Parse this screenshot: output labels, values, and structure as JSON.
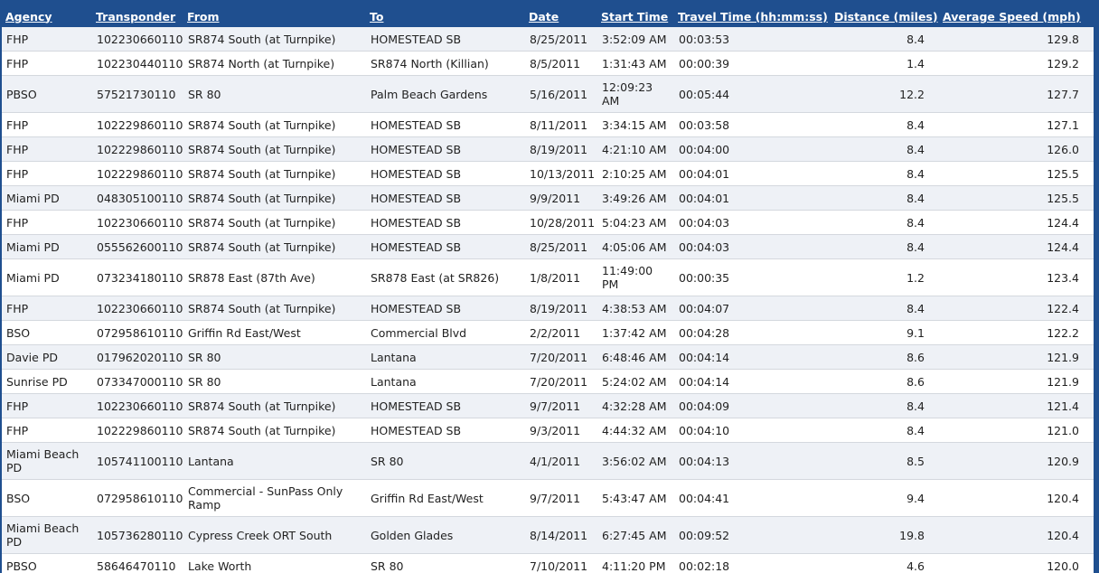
{
  "columns": [
    "Agency",
    "Transponder",
    "From",
    "To",
    "Date",
    "Start Time",
    "Travel Time (hh:mm:ss)",
    "Distance (miles)",
    "Average Speed (mph)"
  ],
  "rows": [
    [
      "FHP",
      "102230660110",
      "SR874 South (at Turnpike)",
      "HOMESTEAD SB",
      "8/25/2011",
      "3:52:09 AM",
      "00:03:53",
      "8.4",
      "129.8"
    ],
    [
      "FHP",
      "102230440110",
      "SR874 North (at Turnpike)",
      "SR874 North (Killian)",
      "8/5/2011",
      "1:31:43 AM",
      "00:00:39",
      "1.4",
      "129.2"
    ],
    [
      "PBSO",
      "57521730110",
      "SR 80",
      "Palm Beach Gardens",
      "5/16/2011",
      "12:09:23 AM",
      "00:05:44",
      "12.2",
      "127.7"
    ],
    [
      "FHP",
      "102229860110",
      "SR874 South (at Turnpike)",
      "HOMESTEAD SB",
      "8/11/2011",
      "3:34:15 AM",
      "00:03:58",
      "8.4",
      "127.1"
    ],
    [
      "FHP",
      "102229860110",
      "SR874 South (at Turnpike)",
      "HOMESTEAD SB",
      "8/19/2011",
      "4:21:10 AM",
      "00:04:00",
      "8.4",
      "126.0"
    ],
    [
      "FHP",
      "102229860110",
      "SR874 South (at Turnpike)",
      "HOMESTEAD SB",
      "10/13/2011",
      "2:10:25 AM",
      "00:04:01",
      "8.4",
      "125.5"
    ],
    [
      "Miami PD",
      "048305100110",
      "SR874 South (at Turnpike)",
      "HOMESTEAD SB",
      "9/9/2011",
      "3:49:26 AM",
      "00:04:01",
      "8.4",
      "125.5"
    ],
    [
      "FHP",
      "102230660110",
      "SR874 South (at Turnpike)",
      "HOMESTEAD SB",
      "10/28/2011",
      "5:04:23 AM",
      "00:04:03",
      "8.4",
      "124.4"
    ],
    [
      "Miami PD",
      "055562600110",
      "SR874 South (at Turnpike)",
      "HOMESTEAD SB",
      "8/25/2011",
      "4:05:06 AM",
      "00:04:03",
      "8.4",
      "124.4"
    ],
    [
      "Miami PD",
      "073234180110",
      "SR878 East (87th Ave)",
      "SR878 East (at SR826)",
      "1/8/2011",
      "11:49:00 PM",
      "00:00:35",
      "1.2",
      "123.4"
    ],
    [
      "FHP",
      "102230660110",
      "SR874 South (at Turnpike)",
      "HOMESTEAD SB",
      "8/19/2011",
      "4:38:53 AM",
      "00:04:07",
      "8.4",
      "122.4"
    ],
    [
      "BSO",
      "072958610110",
      "Griffin Rd East/West",
      "Commercial Blvd",
      "2/2/2011",
      "1:37:42 AM",
      "00:04:28",
      "9.1",
      "122.2"
    ],
    [
      "Davie PD",
      "017962020110",
      "SR 80",
      "Lantana",
      "7/20/2011",
      "6:48:46 AM",
      "00:04:14",
      "8.6",
      "121.9"
    ],
    [
      "Sunrise PD",
      "073347000110",
      "SR 80",
      "Lantana",
      "7/20/2011",
      "5:24:02 AM",
      "00:04:14",
      "8.6",
      "121.9"
    ],
    [
      "FHP",
      "102230660110",
      "SR874 South (at Turnpike)",
      "HOMESTEAD SB",
      "9/7/2011",
      "4:32:28 AM",
      "00:04:09",
      "8.4",
      "121.4"
    ],
    [
      "FHP",
      "102229860110",
      "SR874 South (at Turnpike)",
      "HOMESTEAD SB",
      "9/3/2011",
      "4:44:32 AM",
      "00:04:10",
      "8.4",
      "121.0"
    ],
    [
      "Miami Beach PD",
      "105741100110",
      "Lantana",
      "SR 80",
      "4/1/2011",
      "3:56:02 AM",
      "00:04:13",
      "8.5",
      "120.9"
    ],
    [
      "BSO",
      "072958610110",
      "Commercial - SunPass Only Ramp",
      "Griffin Rd East/West",
      "9/7/2011",
      "5:43:47 AM",
      "00:04:41",
      "9.4",
      "120.4"
    ],
    [
      "Miami Beach PD",
      "105736280110",
      "Cypress Creek ORT South",
      "Golden Glades",
      "8/14/2011",
      "6:27:45 AM",
      "00:09:52",
      "19.8",
      "120.4"
    ],
    [
      "PBSO",
      "58646470110",
      "Lake Worth",
      "SR 80",
      "7/10/2011",
      "4:11:20 PM",
      "00:02:18",
      "4.6",
      "120.0"
    ]
  ]
}
